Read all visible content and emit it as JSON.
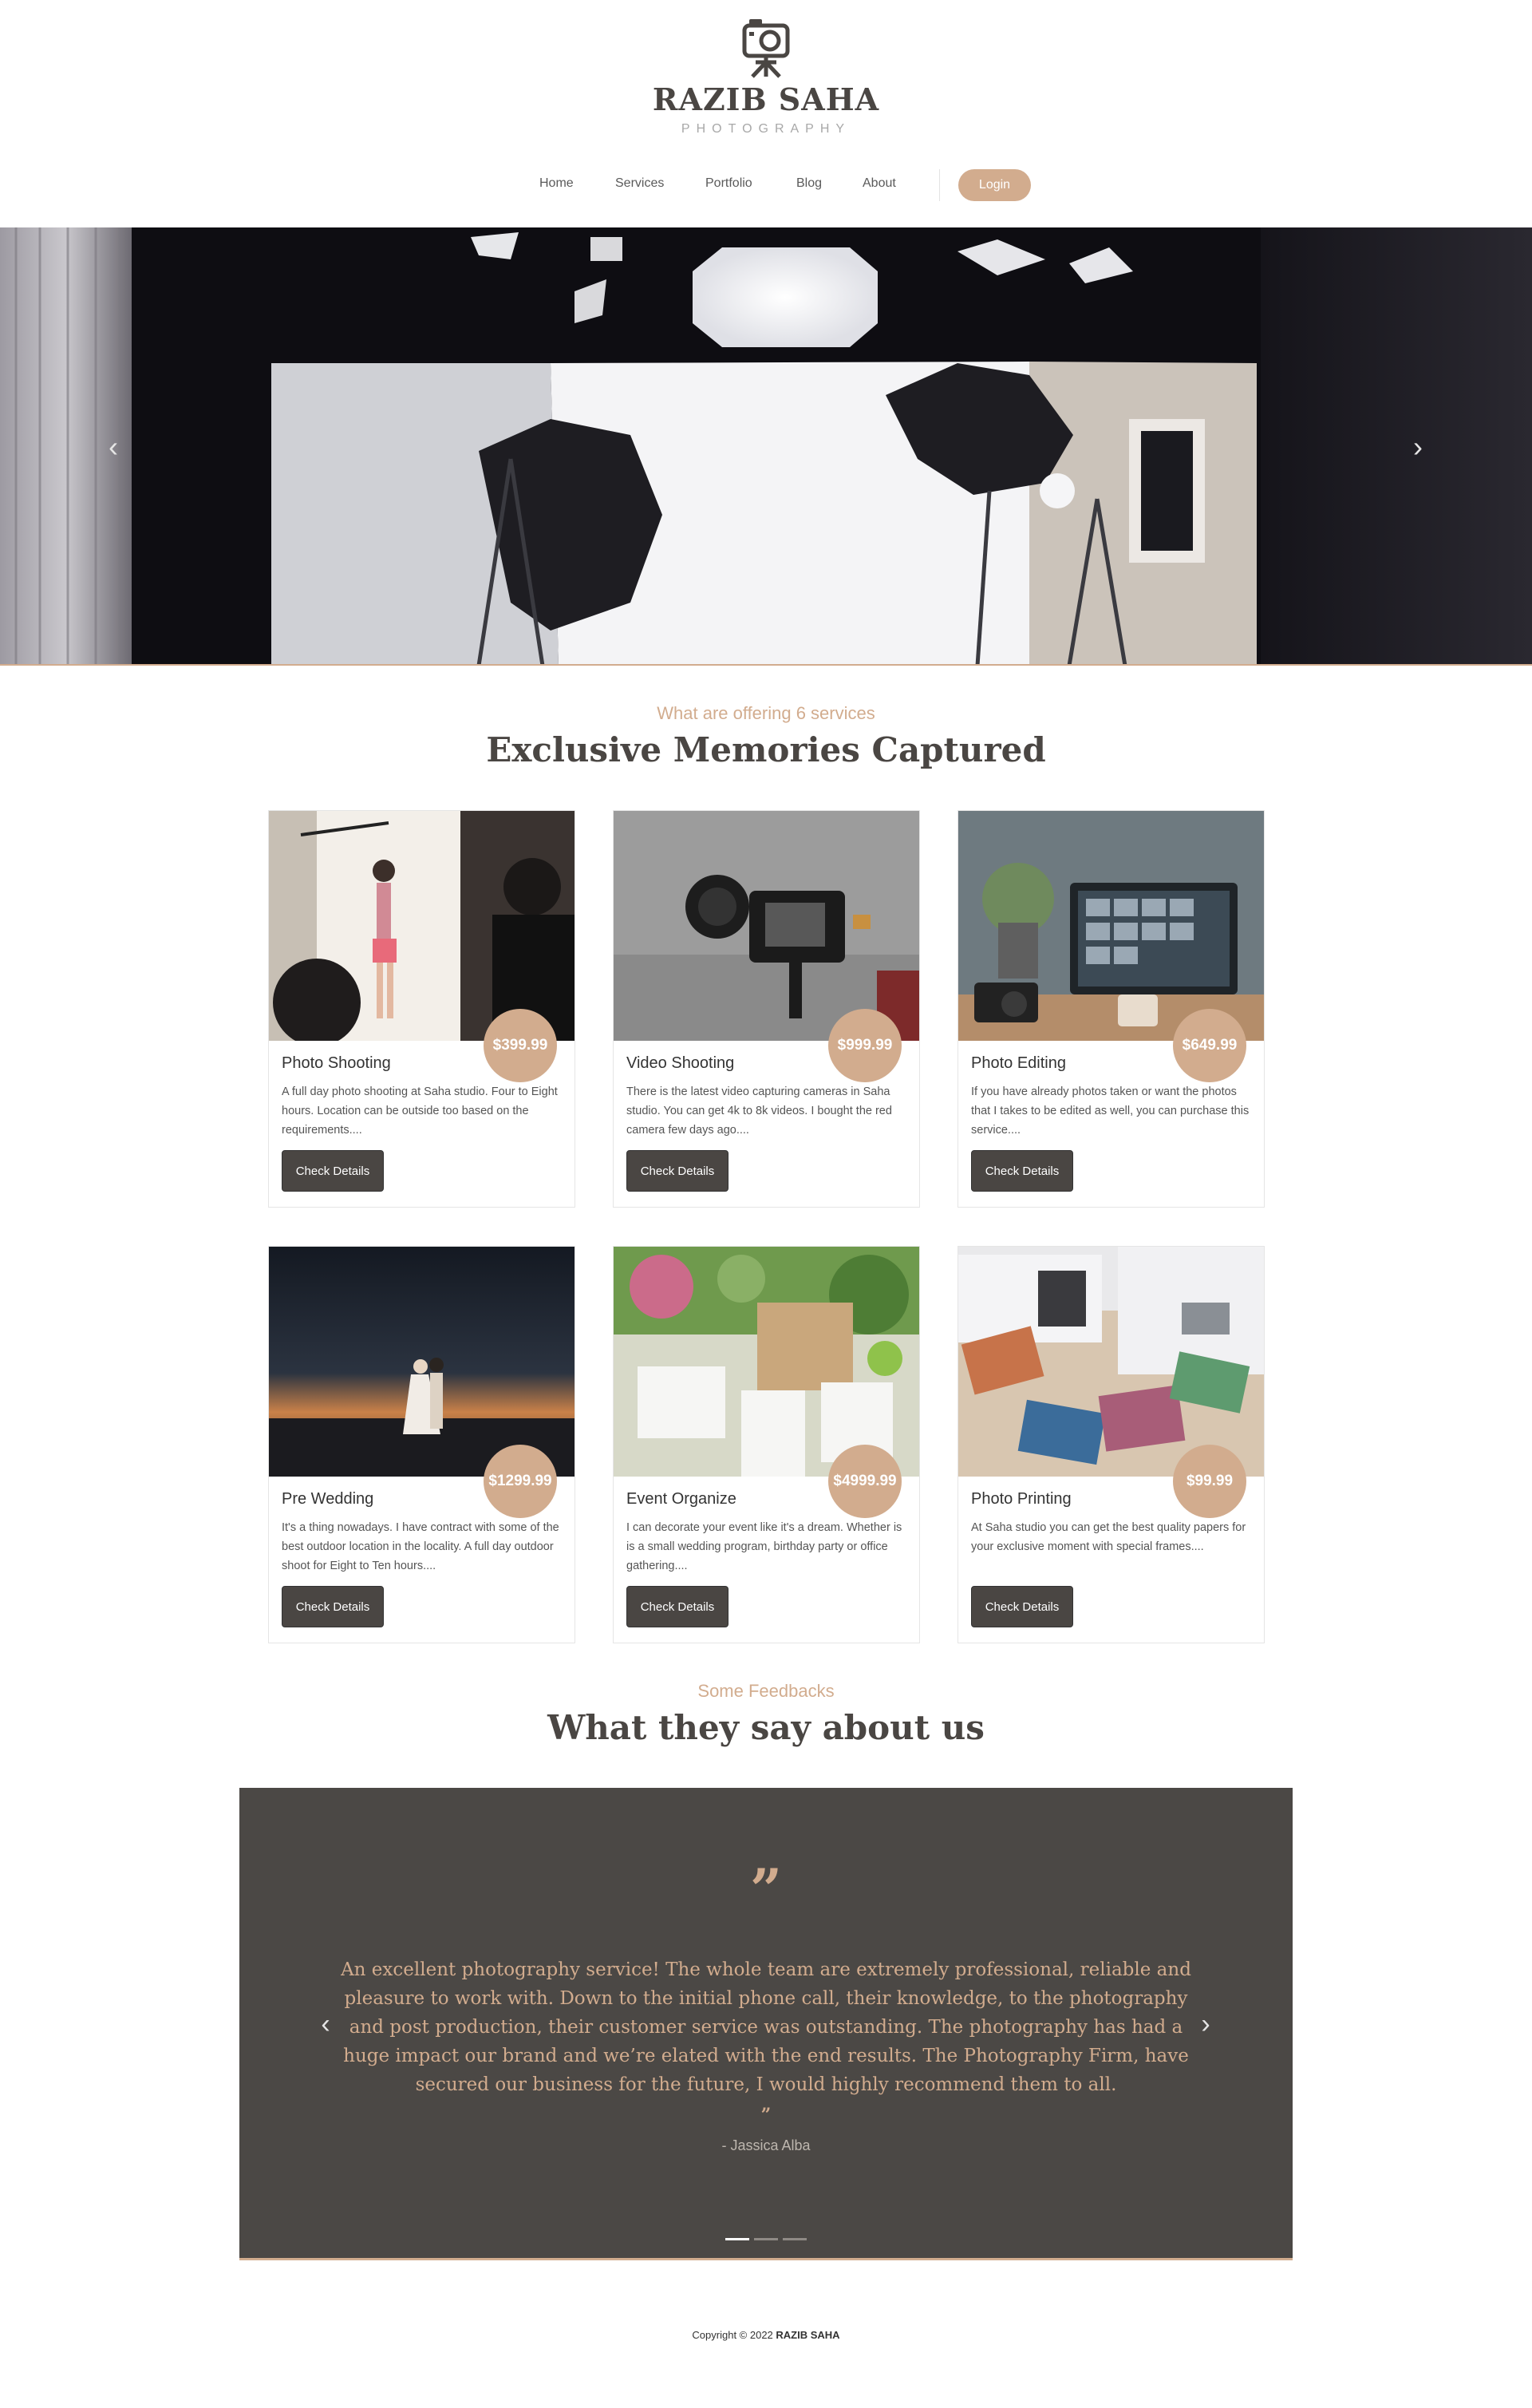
{
  "brand": {
    "name": "RAZIB SAHA",
    "tagline": "PHOTOGRAPHY"
  },
  "nav": {
    "items": [
      "Home",
      "Services",
      "Portfolio",
      "Blog",
      "About"
    ],
    "login": "Login"
  },
  "hero": {
    "prev_arrow": "‹",
    "next_arrow": "›"
  },
  "services": {
    "subtitle": "What are offering 6 services",
    "title": "Exclusive Memories Captured",
    "button_label": "Check Details",
    "cards": [
      {
        "title": "Photo Shooting",
        "price": "$399.99",
        "desc": "A full day photo shooting at Saha studio. Four to Eight hours. Location can be outside too based on the requirements...."
      },
      {
        "title": "Video Shooting",
        "price": "$999.99",
        "desc": "There is the latest video capturing cameras in Saha studio. You can get 4k to 8k videos. I bought the red camera few days ago...."
      },
      {
        "title": "Photo Editing",
        "price": "$649.99",
        "desc": "If you have already photos taken or want the photos that I takes to be edited as well, you can purchase this service...."
      },
      {
        "title": "Pre Wedding",
        "price": "$1299.99",
        "desc": "It's a thing nowadays. I have contract with some of the best outdoor location in the locality. A full day outdoor shoot for Eight to Ten hours...."
      },
      {
        "title": "Event Organize",
        "price": "$4999.99",
        "desc": "I can decorate your event like it's a dream. Whether is is a small wedding program, birthday party or office gathering...."
      },
      {
        "title": "Photo Printing",
        "price": "$99.99",
        "desc": "At Saha studio you can get the best quality papers for your exclusive moment with special frames...."
      }
    ]
  },
  "testimonials": {
    "subtitle": "Some Feedbacks",
    "title": "What they say about us",
    "open_quote": "”",
    "close_quote": "”",
    "text": "An excellent photography service! The whole team are extremely professional, reliable and pleasure to work with. Down to the initial phone call, their knowledge, to the photography and post production, their customer service was outstanding. The photography has had a huge impact our brand and we’re elated with the end results. The Photography Firm, have secured our business for the future, I would highly recommend them to all.",
    "author": "- Jassica Alba",
    "prev_arrow": "‹",
    "next_arrow": "›"
  },
  "footer": {
    "copyright": "Copyright © 2022",
    "owner": "RAZIB SAHA"
  },
  "colors": {
    "accent": "#d2ac8e",
    "dark": "#4a4643"
  }
}
